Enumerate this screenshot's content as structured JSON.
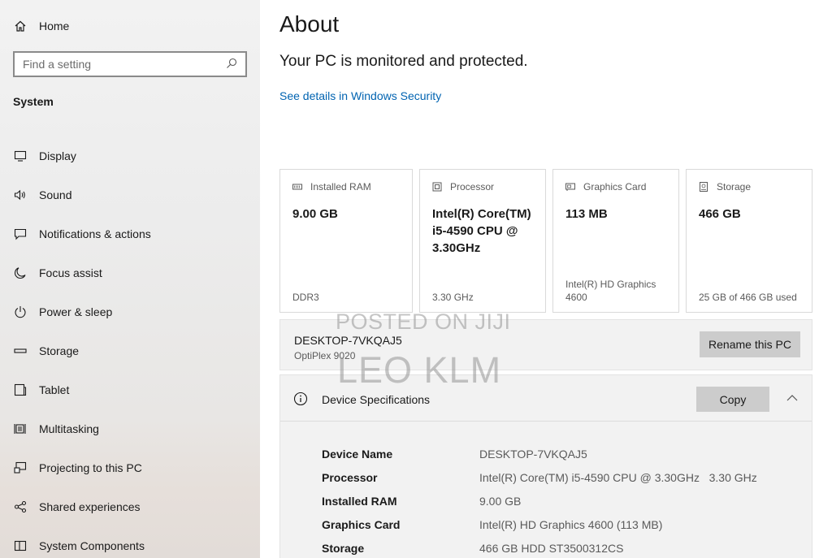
{
  "sidebar": {
    "home_label": "Home",
    "search_placeholder": "Find a setting",
    "section_title": "System",
    "items": [
      {
        "label": "Display",
        "icon": "display-icon"
      },
      {
        "label": "Sound",
        "icon": "sound-icon"
      },
      {
        "label": "Notifications & actions",
        "icon": "notifications-icon"
      },
      {
        "label": "Focus assist",
        "icon": "moon-icon"
      },
      {
        "label": "Power & sleep",
        "icon": "power-icon"
      },
      {
        "label": "Storage",
        "icon": "storage-icon"
      },
      {
        "label": "Tablet",
        "icon": "tablet-icon"
      },
      {
        "label": "Multitasking",
        "icon": "multitasking-icon"
      },
      {
        "label": "Projecting to this PC",
        "icon": "projecting-icon"
      },
      {
        "label": "Shared experiences",
        "icon": "shared-icon"
      },
      {
        "label": "System Components",
        "icon": "components-icon"
      }
    ]
  },
  "main": {
    "title": "About",
    "protection_text": "Your PC is monitored and protected.",
    "security_link": "See details in Windows Security",
    "cards": [
      {
        "label": "Installed RAM",
        "value": "9.00 GB",
        "sub": "DDR3",
        "icon": "ram-icon"
      },
      {
        "label": "Processor",
        "value": "Intel(R) Core(TM) i5-4590 CPU @ 3.30GHz",
        "sub": "3.30 GHz",
        "icon": "processor-icon"
      },
      {
        "label": "Graphics Card",
        "value": "113 MB",
        "sub": "Intel(R) HD Graphics 4600",
        "icon": "graphics-card-icon"
      },
      {
        "label": "Storage",
        "value": "466 GB",
        "sub": "25 GB of 466 GB used",
        "icon": "storage-drive-icon"
      }
    ],
    "pc_name": "DESKTOP-7VKQAJ5",
    "pc_model": "OptiPlex 9020",
    "rename_button": "Rename this PC",
    "specs": {
      "title": "Device Specifications",
      "copy_button": "Copy",
      "rows": [
        {
          "key": "Device Name",
          "value": "DESKTOP-7VKQAJ5"
        },
        {
          "key": "Processor",
          "value": "Intel(R) Core(TM) i5-4590 CPU @ 3.30GHz   3.30 GHz"
        },
        {
          "key": "Installed RAM",
          "value": "9.00 GB"
        },
        {
          "key": "Graphics Card",
          "value": "Intel(R) HD Graphics 4600 (113 MB)"
        },
        {
          "key": "Storage",
          "value": "466 GB HDD ST3500312CS"
        }
      ]
    }
  },
  "watermark": {
    "line1": "POSTED ON JIJI",
    "line2": "LEO KLM"
  },
  "colors": {
    "link": "#0063b1",
    "button_bg": "#cccccc",
    "panel_bg": "#f2f2f2"
  }
}
